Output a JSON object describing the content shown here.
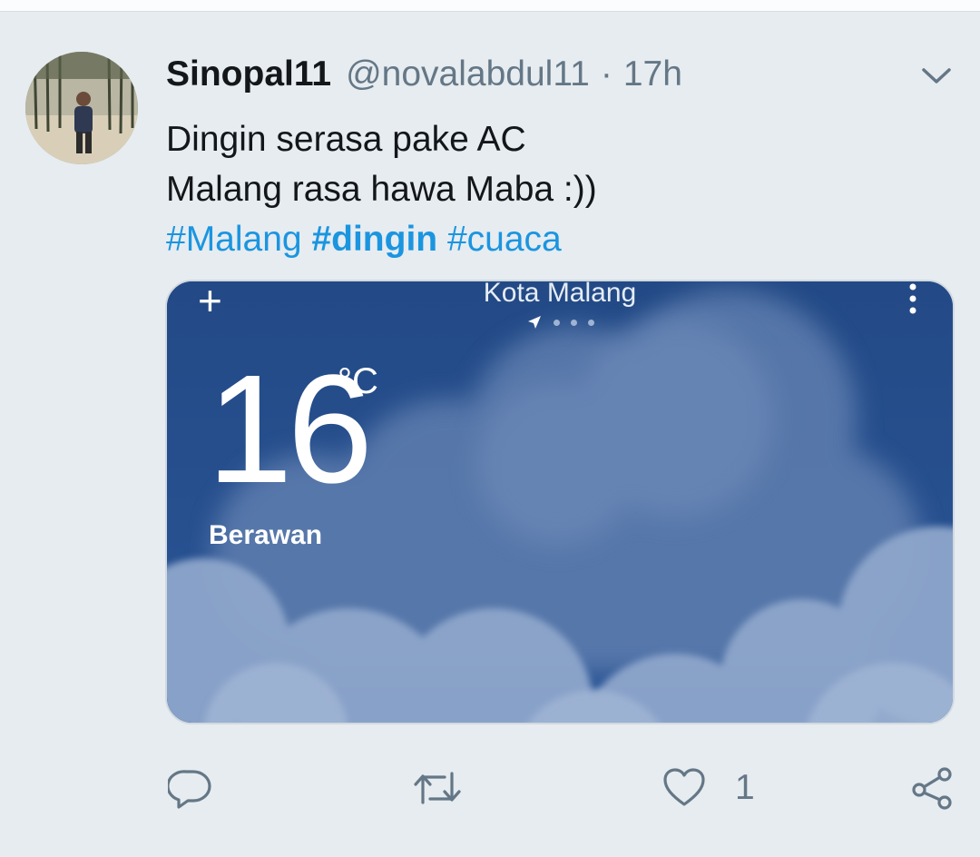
{
  "tweet": {
    "display_name": "Sinopal11",
    "handle": "@novalabdul11",
    "separator": "·",
    "time": "17h",
    "caret_icon": "chevron-down-icon",
    "text_line_1": "Dingin serasa pake AC",
    "text_line_2": "Malang rasa hawa Maba :))",
    "hashtags": [
      "#Malang",
      "#dingin",
      "#cuaca"
    ]
  },
  "media": {
    "city": "Kota Malang",
    "temperature": "16",
    "unit": "°C",
    "condition": "Berawan",
    "add_icon": "plus-icon",
    "menu_icon": "more-vertical-icon",
    "location_icon": "location-arrow-icon",
    "page_dots": 3
  },
  "actions": {
    "reply_icon": "reply-icon",
    "retweet_icon": "retweet-icon",
    "like_icon": "heart-icon",
    "like_count": "1",
    "share_icon": "share-icon"
  },
  "colors": {
    "background": "#e6ecf0",
    "text": "#14171a",
    "secondary": "#657786",
    "link": "#1b95e0",
    "sky": "#27508e"
  }
}
